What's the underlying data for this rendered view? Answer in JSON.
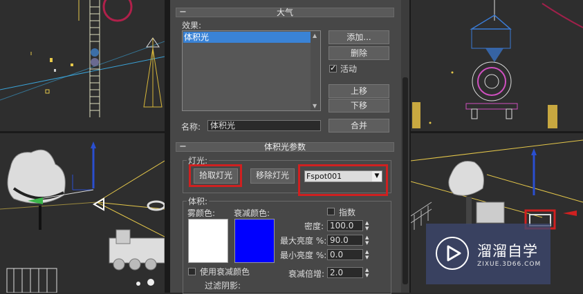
{
  "atmosphere": {
    "title": "大气",
    "effects_label": "效果:",
    "effects_list": [
      "体积光"
    ],
    "add_button": "添加...",
    "delete_button": "删除",
    "active_label": "活动",
    "active_checked": true,
    "move_up_button": "上移",
    "move_down_button": "下移",
    "name_label": "名称:",
    "name_value": "体积光",
    "merge_button": "合并"
  },
  "volume_light_params": {
    "title": "体积光参数",
    "lights_group": "灯光:",
    "pick_light_button": "拾取灯光",
    "remove_light_button": "移除灯光",
    "light_dropdown_value": "Fspot001",
    "volume_group": "体积:",
    "fog_color_label": "雾颜色:",
    "fog_color": "#ffffff",
    "atten_color_label": "衰减颜色:",
    "atten_color": "#0000ff",
    "exponential_label": "指数",
    "exponential_checked": false,
    "density_label": "密度:",
    "density_value": "100.0",
    "max_brightness_label": "最大亮度 %:",
    "max_brightness_value": "90.0",
    "min_brightness_label": "最小亮度 %:",
    "min_brightness_value": "0.0",
    "use_atten_color_label": "使用衰减颜色",
    "use_atten_color_checked": false,
    "atten_mult_label": "衰减倍增:",
    "atten_mult_value": "2.0",
    "filter_shadows_label": "过滤阴影:"
  },
  "highlight_color": "#d02020",
  "watermark": {
    "name": "溜溜自学",
    "url": "ZIXUE.3D66.COM",
    "icon": "play-icon"
  }
}
